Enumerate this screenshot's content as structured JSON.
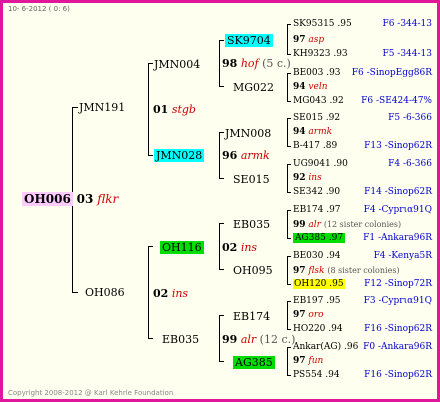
{
  "date": "10- 6-2012 ( 0: 6)",
  "copyright": "Copyright 2008-2012 @ Karl Kehrle Foundation",
  "root": {
    "name": "OH006",
    "year": "03",
    "code": "flkr"
  },
  "gen2": [
    {
      "name": "JMN191"
    },
    {
      "name": "OH086",
      "year": "02",
      "code": "ins"
    }
  ],
  "gen3": [
    {
      "name": "JMN004",
      "year": "01",
      "code": "stgb"
    },
    {
      "name": "JMN028"
    },
    {
      "name": "OH116",
      "year": "02",
      "code": "ins"
    },
    {
      "name": "EB035",
      "year": "99",
      "code": "alr",
      "note": "(12 c.)"
    }
  ],
  "gen4": [
    {
      "name": "SK9704",
      "year": "98",
      "code": "hof",
      "note": "(5 c.)"
    },
    {
      "name": "MG022"
    },
    {
      "name": "JMN008",
      "year": "96",
      "code": "armk"
    },
    {
      "name": "SE015"
    },
    {
      "name": "EB035"
    },
    {
      "name": "OH095"
    },
    {
      "name": "EB174"
    },
    {
      "name": "AG385"
    }
  ],
  "gen5": [
    {
      "name": "SK95315 .95",
      "origin": "F6 -344-13"
    },
    {
      "year": "97",
      "code": "asp"
    },
    {
      "name": "KH9323 .93",
      "origin": "F5 -344-13"
    },
    {
      "name": "BE003 .93",
      "origin": "F6 -SinopEgg86R"
    },
    {
      "year": "94",
      "code": "veln"
    },
    {
      "name": "MG043 .92",
      "origin": "F6 -SE424-47%"
    },
    {
      "name": "SE015 .92",
      "origin": "F5 -6-366"
    },
    {
      "year": "94",
      "code": "armk"
    },
    {
      "name": "B-417 .89",
      "origin": "F13 -Sinop62R"
    },
    {
      "name": "UG9041 .90",
      "origin": "F4 -6-366"
    },
    {
      "year": "92",
      "code": "ins"
    },
    {
      "name": "SE342 .90",
      "origin": "F14 -Sinop62R"
    },
    {
      "name": "EB174 .97",
      "origin": "F4 -Cyprια91Q"
    },
    {
      "year": "99",
      "code": "alr",
      "note": "(12 sister colonies)"
    },
    {
      "name": "AG385 .97",
      "origin": "F1 -Ankara96R"
    },
    {
      "name": "BE030 .94",
      "origin": "F4 -Kenya5R"
    },
    {
      "year": "97",
      "code": "flsk",
      "note": "(8 sister colonies)"
    },
    {
      "name": "OH120 .95",
      "origin": "F12 -Sinop72R"
    },
    {
      "name": "EB197 .95",
      "origin": "F3 -Cyprια91Q"
    },
    {
      "year": "97",
      "code": "oro"
    },
    {
      "name": "HO220 .94",
      "origin": "F16 -Sinop62R"
    },
    {
      "name": "Ankar(AG) .96",
      "origin": "F0 -Ankara96R"
    },
    {
      "year": "97",
      "code": "fun"
    },
    {
      "name": "PS554 .94",
      "origin": "F16 -Sinop62R"
    }
  ]
}
